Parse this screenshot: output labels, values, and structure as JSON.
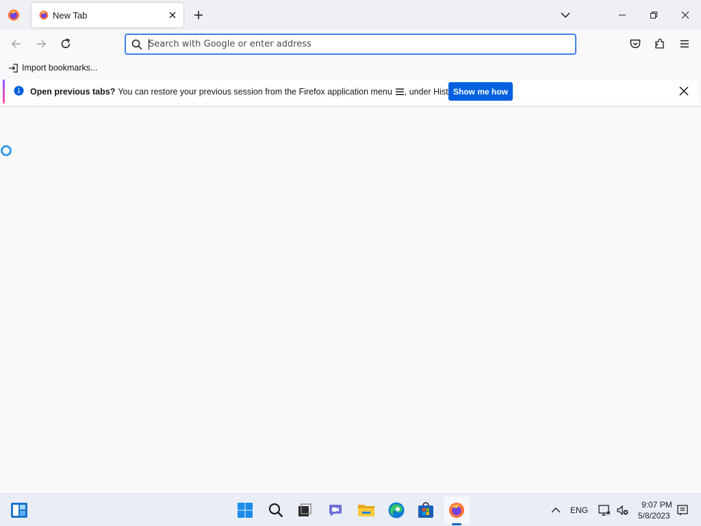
{
  "tab": {
    "title": "New Tab"
  },
  "urlbar": {
    "placeholder": "Search with Google or enter address"
  },
  "bookmarks": {
    "import_label": "Import bookmarks..."
  },
  "notification": {
    "bold_text": "Open previous tabs?",
    "message_before_icon": "You can restore your previous session from the Firefox application menu",
    "message_after_icon": ", under History.",
    "button_label": "Show me how"
  },
  "taskbar": {
    "pinned": [
      "widgets-icon",
      "start-icon",
      "search-icon",
      "task-view-icon",
      "chat-icon",
      "file-explorer-icon",
      "edge-icon",
      "store-icon",
      "firefox-icon"
    ],
    "language": "ENG",
    "time": "9:07 PM",
    "date": "5/8/2023"
  },
  "colors": {
    "accent": "#0061e0",
    "urlbar_focus": "#3b7ee8",
    "taskbar_active": "#0067c0"
  }
}
